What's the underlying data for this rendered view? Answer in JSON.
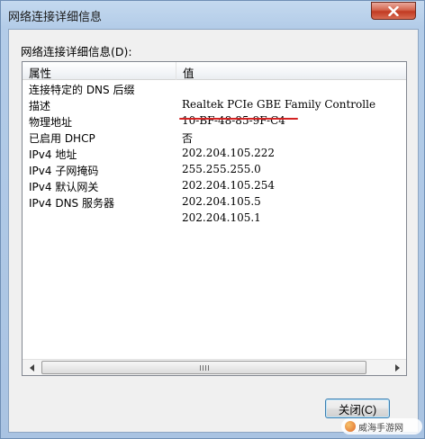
{
  "window": {
    "title": "网络连接详细信息",
    "close_icon": "close-icon"
  },
  "details": {
    "group_label": "网络连接详细信息(D):",
    "columns": {
      "property": "属性",
      "value": "值"
    },
    "rows": [
      {
        "property": "连接特定的 DNS 后缀",
        "value": ""
      },
      {
        "property": "描述",
        "value": "Realtek PCIe GBE Family Controlle"
      },
      {
        "property": "物理地址",
        "value": "10-BF-48-85-9F-C4"
      },
      {
        "property": "已启用 DHCP",
        "value": "否"
      },
      {
        "property": "IPv4 地址",
        "value": "202.204.105.222"
      },
      {
        "property": "IPv4 子网掩码",
        "value": "255.255.255.0"
      },
      {
        "property": "IPv4 默认网关",
        "value": "202.204.105.254"
      },
      {
        "property": "IPv4 DNS 服务器",
        "value": "202.204.105.5"
      },
      {
        "property": "",
        "value": "202.204.105.1"
      }
    ],
    "highlight_color": "#d42222"
  },
  "footer": {
    "close_button": "关闭(C)"
  },
  "watermark": {
    "text": "威海手游网"
  }
}
